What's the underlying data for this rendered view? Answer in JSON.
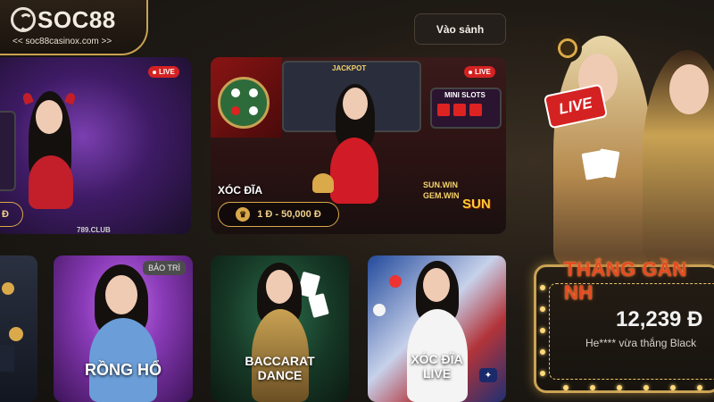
{
  "logo": {
    "name": "SOC88",
    "subtitle": "<< soc88casinox.com >>"
  },
  "header": {
    "lobby_button": "Vào sảnh"
  },
  "cards": [
    {
      "id": "live-1",
      "live_label": "LIVE",
      "bet_partial": "Đ",
      "brand": "789",
      "brand_sub": "789.CLUB"
    },
    {
      "id": "xoc-dia",
      "title": "XÓC ĐĨA",
      "live_label": "LIVE",
      "bet_range": "1 Đ - 50,000 Đ",
      "brand": "SUN",
      "signs": [
        "SUN.WIN",
        "GEM.WIN",
        "MINI SLOTS",
        "JACKPOT"
      ]
    },
    {
      "id": "rong-ho",
      "title": "RỒNG HỔ",
      "badge": "BẢO TRÌ"
    },
    {
      "id": "baccarat-dance",
      "title_line1": "BACCARAT",
      "title_line2": "DANCE"
    },
    {
      "id": "xoc-dia-live",
      "title_line1": "XÓC ĐĨA",
      "title_line2": "LIVE"
    }
  ],
  "promo": {
    "live_sign": "LIVE",
    "winner_title": "THẮNG GẦN NH",
    "amount": "12,239 Đ",
    "message": "He**** vừa thắng Black"
  },
  "colors": {
    "gold": "#d9a94a",
    "live_red": "#d42222",
    "title_orange": "#e84a22"
  }
}
